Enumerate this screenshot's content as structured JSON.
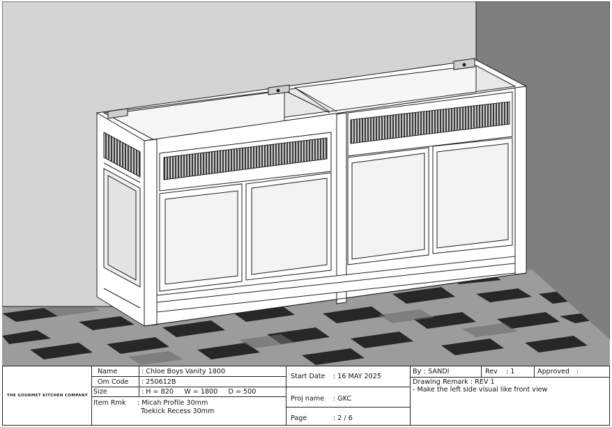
{
  "company": "THE GOURMET KITCHEN COMPANY",
  "fields": {
    "name_label": "Name",
    "name_value": ": Chloe Boys Vanity 1800",
    "om_code_label": "Om Code",
    "om_code_value": ": 250612B",
    "size_label": "Size",
    "size_value": ": H = 820     W = 1800     D = 500",
    "item_rmk_label": "Item Rmk",
    "item_rmk_line1": ": Micah Profile 30mm",
    "item_rmk_line2": "Toekick Recess 30mm",
    "start_date_label": "Start Date",
    "start_date_value": ": 16 MAY 2025",
    "proj_name_label": "Proj name",
    "proj_name_value": ": GKC",
    "page_label": "Page",
    "page_value": ": 2 / 6",
    "by_label": "By",
    "by_value": ": SANDI",
    "rev_label": "Rev",
    "rev_value": ": 1",
    "approved_label": "Approved",
    "approved_value": ":",
    "remark_label": "Drawing Remark : REV 1",
    "remark_text": "- Make the left side visual like front view"
  },
  "colors": {
    "wall_back": "#d2d2d2",
    "wall_side": "#7c7c7c",
    "tile_light": "#9a9a9a",
    "tile_dark": "#262626",
    "cabinet_face": "#ffffff",
    "panel": "#f2f2f2",
    "line": "#1e1e1e"
  }
}
